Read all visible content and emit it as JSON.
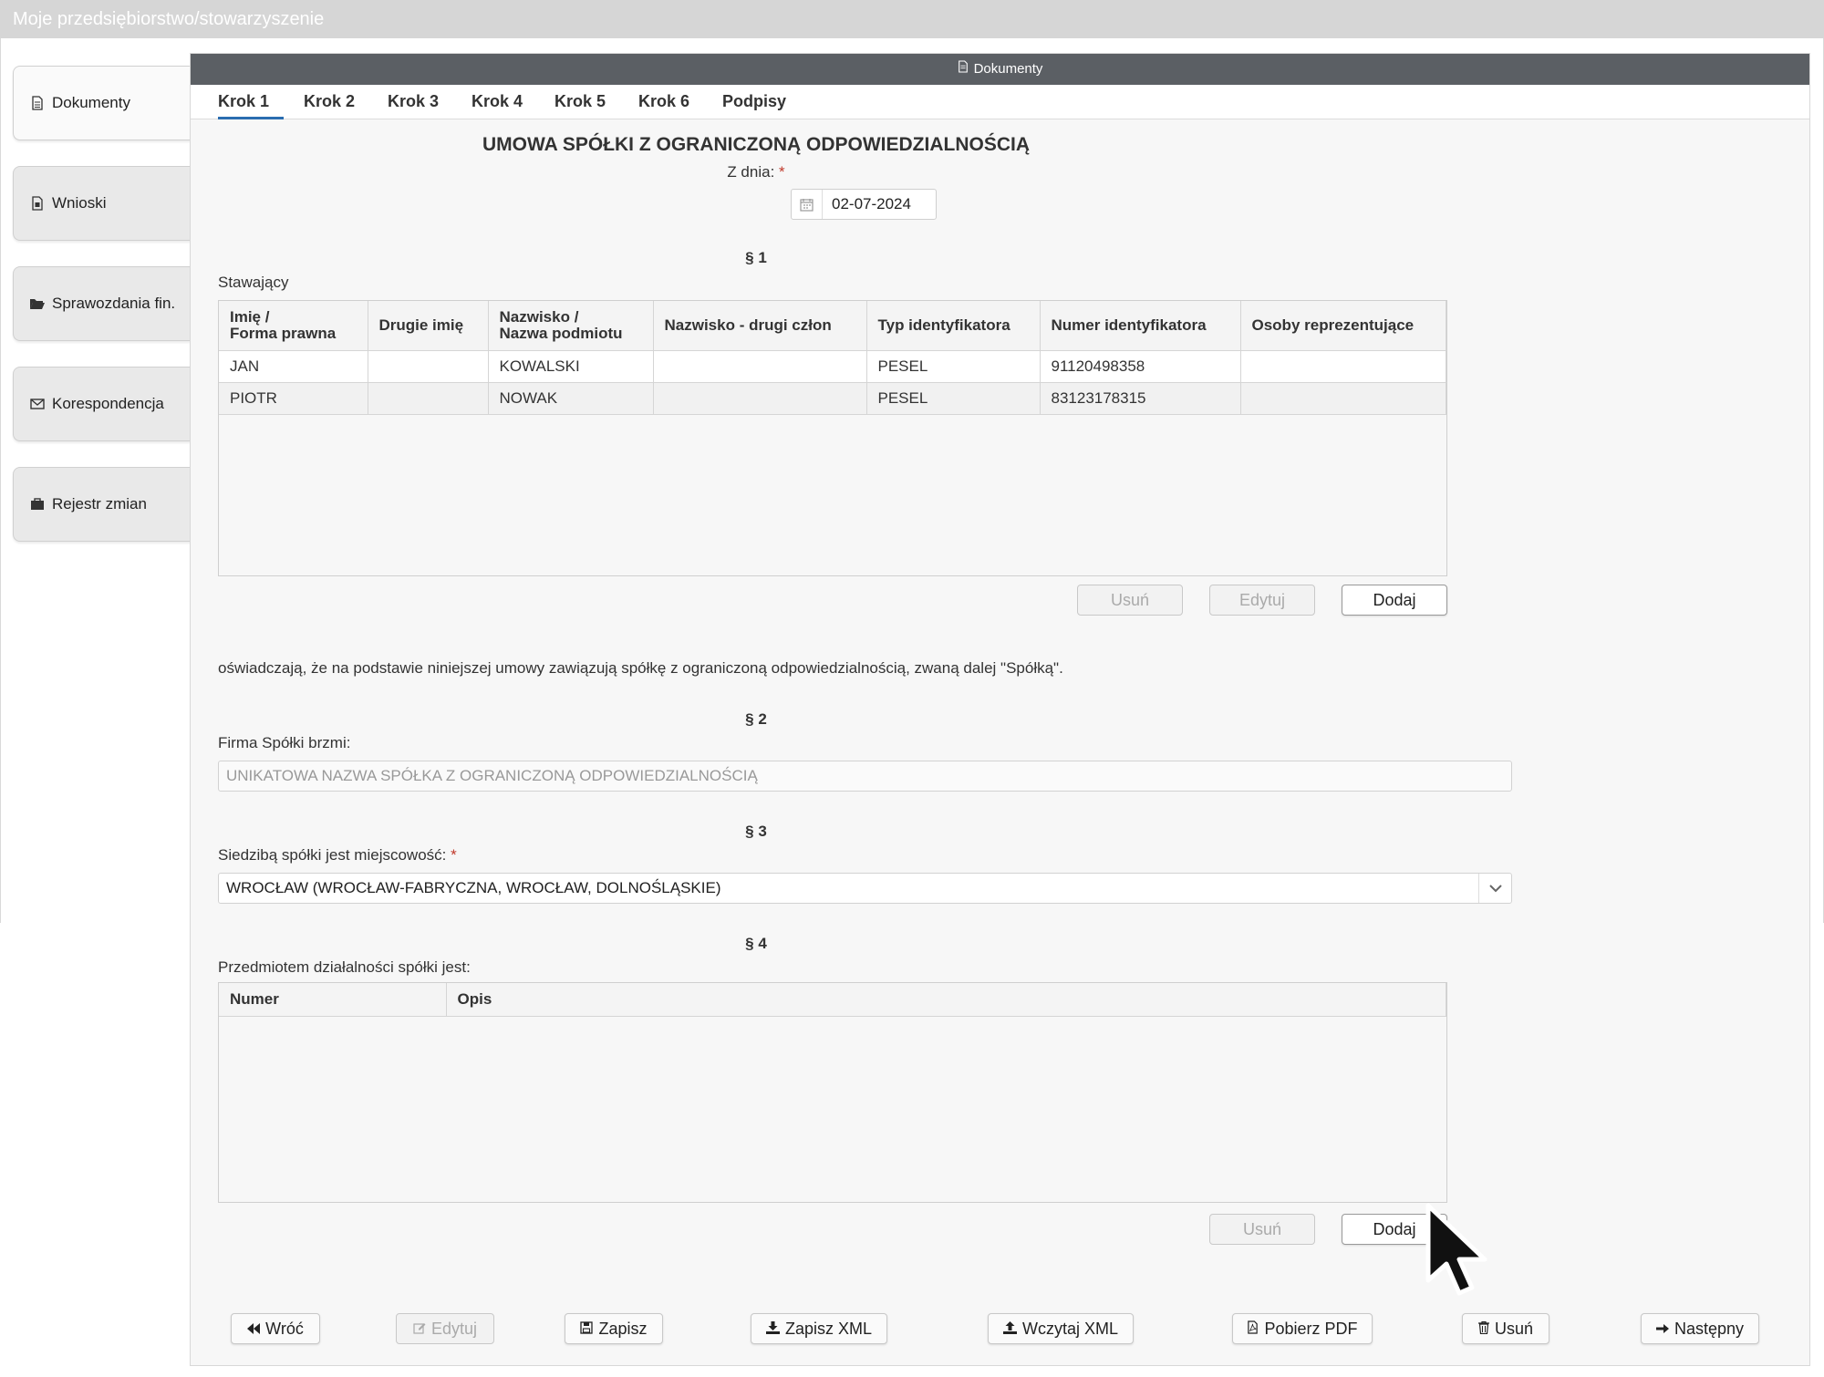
{
  "topbar": {
    "title": "Moje przedsiębiorstwo/stowarzyszenie"
  },
  "sidebar": {
    "items": [
      {
        "label": "Dokumenty",
        "icon": "document-icon"
      },
      {
        "label": "Wnioski",
        "icon": "application-icon"
      },
      {
        "label": "Sprawozdania fin.",
        "icon": "folder-open-icon"
      },
      {
        "label": "Korespondencja",
        "icon": "envelope-icon"
      },
      {
        "label": "Rejestr zmian",
        "icon": "briefcase-icon"
      }
    ]
  },
  "panel": {
    "header": "Dokumenty"
  },
  "tabs": [
    {
      "label": "Krok 1"
    },
    {
      "label": "Krok 2"
    },
    {
      "label": "Krok 3"
    },
    {
      "label": "Krok 4"
    },
    {
      "label": "Krok 5"
    },
    {
      "label": "Krok 6"
    },
    {
      "label": "Podpisy"
    }
  ],
  "form": {
    "title": "UMOWA SPÓŁKI Z OGRANICZONĄ ODPOWIEDZIALNOŚCIĄ",
    "date_label": "Z dnia:",
    "required_mark": "*",
    "date_value": "02-07-2024",
    "s1": "§ 1",
    "s2": "§ 2",
    "s3": "§ 3",
    "s4": "§ 4",
    "parties_label": "Stawający",
    "parties_columns": [
      "Imię / Forma prawna",
      "Drugie imię",
      "Nazwisko / Nazwa podmiotu",
      "Nazwisko - drugi człon",
      "Typ identyfikatora",
      "Numer identyfikatora",
      "Osoby reprezentujące"
    ],
    "parties_rows": [
      [
        "JAN",
        "",
        "KOWALSKI",
        "",
        "PESEL",
        "91120498358",
        ""
      ],
      [
        "PIOTR",
        "",
        "NOWAK",
        "",
        "PESEL",
        "83123178315",
        ""
      ]
    ],
    "parties_buttons": {
      "remove": "Usuń",
      "edit": "Edytuj",
      "add": "Dodaj"
    },
    "statement": "oświadczają, że na podstawie niniejszej umowy zawiązują spółkę z ograniczoną odpowiedzialnością, zwaną dalej \"Spółką\".",
    "company_label": "Firma Spółki brzmi:",
    "company_value": "UNIKATOWA NAZWA SPÓŁKA Z OGRANICZONĄ ODPOWIEDZIALNOŚCIĄ",
    "seat_label": "Siedzibą spółki jest miejscowość:",
    "seat_value": "WROCŁAW (WROCŁAW-FABRYCZNA, WROCŁAW, DOLNOŚLĄSKIE)",
    "activity_label": "Przedmiotem działalności spółki jest:",
    "activity_columns": [
      "Numer",
      "Opis"
    ],
    "activity_buttons": {
      "remove": "Usuń",
      "add": "Dodaj"
    }
  },
  "footer": {
    "back": "Wróć",
    "edit": "Edytuj",
    "save": "Zapisz",
    "save_xml": "Zapisz XML",
    "load_xml": "Wczytaj XML",
    "download_pdf": "Pobierz PDF",
    "delete": "Usuń",
    "next": "Następny"
  }
}
